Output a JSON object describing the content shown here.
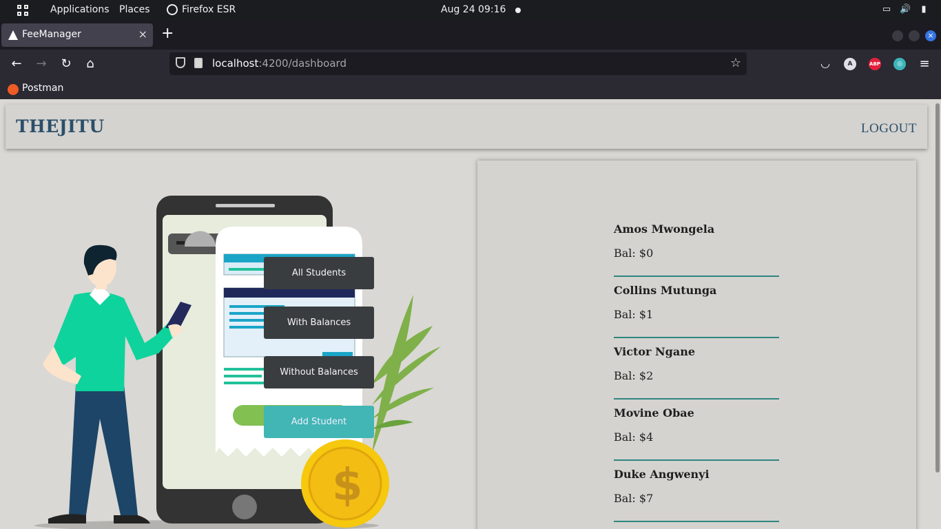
{
  "system_bar": {
    "applications": "Applications",
    "places": "Places",
    "browser_name": "Firefox ESR",
    "clock": "Aug 24  09:16"
  },
  "browser": {
    "tab_title": "FeeManager",
    "url_host": "localhost",
    "url_path": ":4200/dashboard",
    "bookmark": "Postman",
    "extension_a": "A",
    "extension_abp": "ABP"
  },
  "header": {
    "brand": "THEJITU",
    "logout": "LOGOUT"
  },
  "actions": [
    {
      "label": "All Students"
    },
    {
      "label": "With Balances"
    },
    {
      "label": "Without Balances"
    },
    {
      "label": "Add Student"
    }
  ],
  "students": [
    {
      "name": "Amos Mwongela",
      "balance": "Bal: $0"
    },
    {
      "name": "Collins Mutunga",
      "balance": "Bal: $1"
    },
    {
      "name": "Victor Ngane",
      "balance": "Bal: $2"
    },
    {
      "name": "Movine Obae",
      "balance": "Bal: $4"
    },
    {
      "name": "Duke Angwenyi",
      "balance": "Bal: $7"
    }
  ],
  "colors": {
    "brand": "#2c4f6a",
    "divider": "#2e8580",
    "add_button": "#41b6b4",
    "dark_button": "#3a3d40"
  }
}
